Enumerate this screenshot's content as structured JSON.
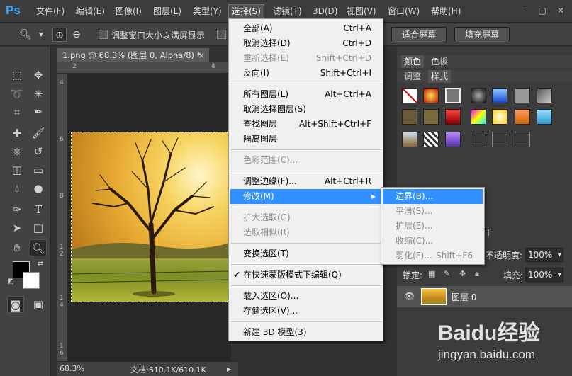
{
  "app": {
    "logo": "Ps"
  },
  "menubar": {
    "items": [
      "文件(F)",
      "编辑(E)",
      "图像(I)",
      "图层(L)",
      "类型(Y)",
      "选择(S)",
      "滤镜(T)",
      "3D(D)",
      "视图(V)",
      "窗口(W)",
      "帮助(H)"
    ],
    "active": "选择(S)"
  },
  "options_bar": {
    "checkbox_label": "调整窗口大小以满屏显示",
    "fit_screen": "适合屏幕",
    "fill_screen": "填充屏幕"
  },
  "document": {
    "tab_title": "1.png @ 68.3% (图层 0, Alpha/8) *",
    "ruler_top": [
      "2",
      "4"
    ],
    "ruler_left": [
      "4",
      "6",
      "8",
      "1",
      "2",
      "1",
      "4",
      "1",
      "6"
    ],
    "zoom": "68.3%",
    "doc_info": "文档:610.1K/610.1K"
  },
  "panels": {
    "color_tabs": [
      "颜色",
      "色板"
    ],
    "adjust_tabs": [
      "调整",
      "样式"
    ],
    "opacity_label": "不透明度:",
    "opacity_value": "100%",
    "lock_label": "锁定:",
    "fill_label": "填充:",
    "fill_value": "100%",
    "layer_name": "图层 0"
  },
  "select_menu": {
    "items": [
      {
        "label": "全部(A)",
        "shortcut": "Ctrl+A",
        "disabled": false
      },
      {
        "label": "取消选择(D)",
        "shortcut": "Ctrl+D",
        "disabled": false
      },
      {
        "label": "重新选择(E)",
        "shortcut": "Shift+Ctrl+D",
        "disabled": true
      },
      {
        "label": "反向(I)",
        "shortcut": "Shift+Ctrl+I",
        "disabled": false
      },
      {
        "label": "所有图层(L)",
        "shortcut": "Alt+Ctrl+A",
        "disabled": false
      },
      {
        "label": "取消选择图层(S)",
        "shortcut": "",
        "disabled": false
      },
      {
        "label": "查找图层",
        "shortcut": "Alt+Shift+Ctrl+F",
        "disabled": false
      },
      {
        "label": "隔离图层",
        "shortcut": "",
        "disabled": false
      },
      {
        "label": "色彩范围(C)...",
        "shortcut": "",
        "disabled": true
      },
      {
        "label": "调整边缘(F)...",
        "shortcut": "Alt+Ctrl+R",
        "disabled": false
      },
      {
        "label": "修改(M)",
        "shortcut": "",
        "disabled": false
      },
      {
        "label": "扩大选取(G)",
        "shortcut": "",
        "disabled": true
      },
      {
        "label": "选取相似(R)",
        "shortcut": "",
        "disabled": true
      },
      {
        "label": "变换选区(T)",
        "shortcut": "",
        "disabled": false
      },
      {
        "label": "在快速蒙版模式下编辑(Q)",
        "shortcut": "",
        "disabled": false
      },
      {
        "label": "载入选区(O)...",
        "shortcut": "",
        "disabled": false
      },
      {
        "label": "存储选区(V)...",
        "shortcut": "",
        "disabled": false
      },
      {
        "label": "新建 3D 模型(3)",
        "shortcut": "",
        "disabled": false
      }
    ]
  },
  "modify_submenu": {
    "items": [
      {
        "label": "边界(B)...",
        "shortcut": "",
        "disabled": false
      },
      {
        "label": "平滑(S)...",
        "shortcut": "",
        "disabled": true
      },
      {
        "label": "扩展(E)...",
        "shortcut": "",
        "disabled": true
      },
      {
        "label": "收缩(C)...",
        "shortcut": "",
        "disabled": true
      },
      {
        "label": "羽化(F)...",
        "shortcut": "Shift+F6",
        "disabled": true
      }
    ]
  },
  "watermark": {
    "brand": "Baidu经验",
    "url": "jingyan.baidu.com"
  },
  "colors": {
    "highlight": "#3390ff",
    "ps_blue": "#31a8ff"
  }
}
